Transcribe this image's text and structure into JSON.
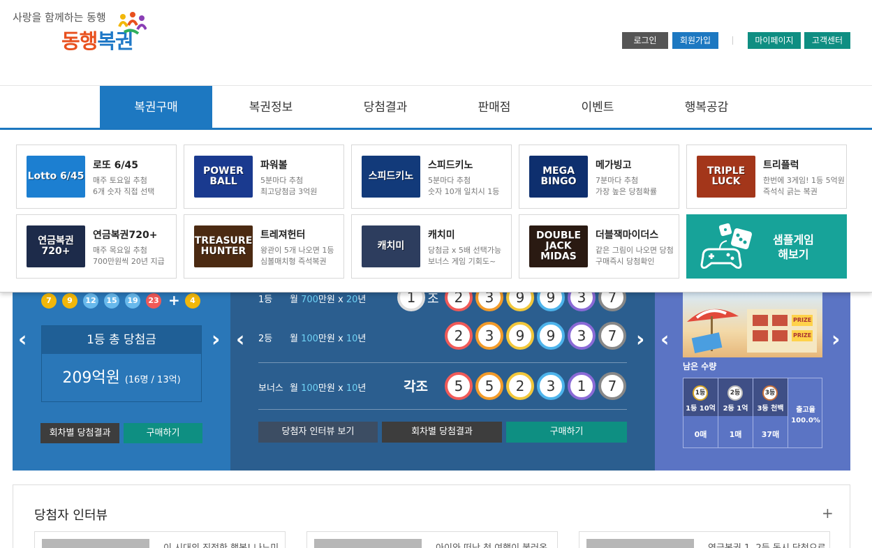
{
  "header": {
    "slogan": "사랑을 함께하는 동행",
    "logo_orange": "동행",
    "logo_blue": "복권",
    "login": "로그인",
    "join": "회원가입",
    "mypage": "마이페이지",
    "customer_center": "고객센터"
  },
  "nav": [
    "복권구매",
    "복권정보",
    "당첨결과",
    "판매점",
    "이벤트",
    "행복공감"
  ],
  "games": [
    {
      "name": "로또 6/45",
      "desc1": "매주 토요일 추첨",
      "desc2": "6개 숫자 직접 선택",
      "thumb": "Lotto 6/45",
      "color": "#1c7fd1"
    },
    {
      "name": "파워볼",
      "desc1": "5분마다 추첨",
      "desc2": "최고당첨금 3억원",
      "thumb": "POWER BALL",
      "color": "#1a3a8f"
    },
    {
      "name": "스피드키노",
      "desc1": "5분마다 추첨",
      "desc2": "숫자 10개 일치시 1등",
      "thumb": "스피드키노",
      "color": "#123a7a"
    },
    {
      "name": "메가빙고",
      "desc1": "7분마다 추첨",
      "desc2": "가장 높은 당첨확률",
      "thumb": "MEGA BINGO",
      "color": "#0e2f6e"
    },
    {
      "name": "트리플럭",
      "desc1": "한번에 3게임! 1등 5억원",
      "desc2": "즉석식 긁는 복권",
      "thumb": "TRIPLE LUCK",
      "color": "#a3361a"
    },
    {
      "name": "연금복권720+",
      "desc1": "매주 목요일 추첨",
      "desc2": "700만원씩 20년 지급",
      "thumb": "연금복권720+",
      "color": "#1d2b4a"
    },
    {
      "name": "트레져헌터",
      "desc1": "왕관이 5개 나오면 1등",
      "desc2": "심볼매치형 즉석복권",
      "thumb": "TREASURE HUNTER",
      "color": "#4b2a12"
    },
    {
      "name": "캐치미",
      "desc1": "당첨금 x 5배 선택가능",
      "desc2": "보너스 게임 기회도~",
      "thumb": "캐치미",
      "color": "#2d3d5e"
    },
    {
      "name": "더블잭마이더스",
      "desc1": "같은 그림이 나오면 당첨",
      "desc2": "구매즉시 당첨확인",
      "thumb": "DOUBLE JACK MIDAS",
      "color": "#2a1a12"
    }
  ],
  "sample_game": {
    "line1": "샘플게임",
    "line2": "해보기"
  },
  "lotto": {
    "numbers": [
      "7",
      "9",
      "12",
      "15",
      "19",
      "23"
    ],
    "bonus": "4",
    "ball_colors": [
      "#f2b70a",
      "#f2b70a",
      "#68b9ec",
      "#68b9ec",
      "#68b9ec",
      "#f05a58"
    ],
    "bonus_color": "#f2b70a",
    "prize_label": "1등 총 당첨금",
    "prize_amount": "209억원",
    "prize_detail": "(16명 / 13억)",
    "btn_results": "회차별 당첨결과",
    "btn_buy": "구매하기"
  },
  "pension": {
    "rank1": "1등",
    "rank1_desc": {
      "prefix": "월 ",
      "amount": "700",
      "mid": "만원 x ",
      "years": "20",
      "suffix": "년"
    },
    "rank1_group": "1",
    "rank1_group_suffix": "조",
    "rank1_numbers": [
      "2",
      "3",
      "9",
      "9",
      "3",
      "7"
    ],
    "rank2": "2등",
    "rank2_desc": {
      "prefix": "월 ",
      "amount": "100",
      "mid": "만원 x ",
      "years": "10",
      "suffix": "년"
    },
    "rank2_numbers": [
      "2",
      "3",
      "9",
      "9",
      "3",
      "7"
    ],
    "bonus": "보너스",
    "bonus_desc": {
      "prefix": "월 ",
      "amount": "100",
      "mid": "만원 x ",
      "years": "10",
      "suffix": "년"
    },
    "bonus_group": "각조",
    "bonus_numbers": [
      "5",
      "5",
      "2",
      "3",
      "1",
      "7"
    ],
    "ring_colors": [
      "#f05a58",
      "#f29b2a",
      "#f2c73a",
      "#4db4ec",
      "#8a6ad6",
      "#888888"
    ],
    "btn_interview": "당첨자 인터뷰 보기",
    "btn_results": "회차별 당첨결과",
    "btn_buy": "구매하기"
  },
  "scratch": {
    "remain_label": "남은 수량",
    "prize_tag": "PRIZE",
    "items": [
      {
        "medal": "1등",
        "name": "1등 10억",
        "count": "0매"
      },
      {
        "medal": "2등",
        "name": "2등 1억",
        "count": "1매"
      },
      {
        "medal": "3등",
        "name": "3등 천백",
        "count": "37매"
      }
    ],
    "rate_label": "출고율",
    "rate_value": "100.0%"
  },
  "interview": {
    "title": "당첨자 인터뷰",
    "plus": "+",
    "items": [
      "이 시대의 진정한 행복! 나느미",
      "아이와 떠난 첫 여행이 불러온",
      "연금복권 1, 2등 동시 당첨으로"
    ]
  }
}
